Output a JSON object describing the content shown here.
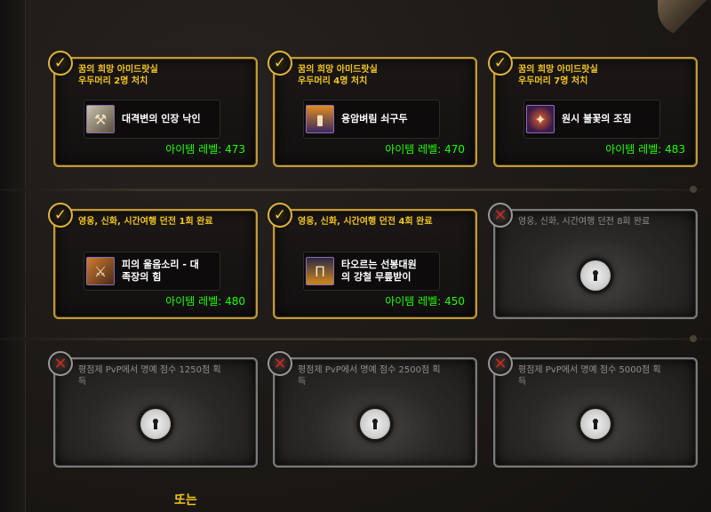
{
  "rows": [
    {
      "cards": [
        {
          "status": "complete",
          "requirement": "꿈의 희망 아미드랏실\n우두머리 2명 처치",
          "item": {
            "name": "대격변의 인장 낙인",
            "icon": "branding-iron-icon"
          },
          "item_level": "아이템 레벨: 473"
        },
        {
          "status": "complete",
          "requirement": "꿈의 희망 아미드랏실\n우두머리 4명 처치",
          "item": {
            "name": "용암벼림 쇠구두",
            "icon": "molten-boots-icon"
          },
          "item_level": "아이템 레벨: 470"
        },
        {
          "status": "complete",
          "requirement": "꿈의 희망 아미드랏실\n우두머리 7명 처치",
          "item": {
            "name": "원시 불꽃의 조짐",
            "icon": "primal-flame-icon"
          },
          "item_level": "아이템 레벨: 483"
        }
      ]
    },
    {
      "cards": [
        {
          "status": "complete",
          "requirement": "영웅, 신화, 시간여행 던전 1회 완료",
          "item": {
            "name": "피의 울음소리 - 대\n족장의 힘",
            "icon": "war-axe-icon"
          },
          "item_level": "아이템 레벨: 480"
        },
        {
          "status": "complete",
          "requirement": "영웅, 신화, 시간여행 던전 4회 완료",
          "item": {
            "name": "타오르는 선봉대원\n의 강철 무릎받이",
            "icon": "legguards-icon"
          },
          "item_level": "아이템 레벨: 450"
        },
        {
          "status": "locked",
          "requirement": "영웅, 신화, 시간여행 던전 8회 완료"
        }
      ]
    },
    {
      "cards": [
        {
          "status": "locked",
          "requirement": "평점제 PvP에서 명예 점수 1250점 획\n득"
        },
        {
          "status": "locked",
          "requirement": "평점제 PvP에서 명예 점수 2500점 획\n득"
        },
        {
          "status": "locked",
          "requirement": "평점제 PvP에서 명예 점수 5000점 획\n득"
        }
      ]
    }
  ],
  "footer": {
    "or_label": "또는"
  },
  "colors": {
    "gold_border": "#c29a35",
    "requirement_text": "#f0c420",
    "item_level_text": "#1eff00",
    "locked_border": "#7a7a78",
    "fail_mark": "#d0271b"
  }
}
